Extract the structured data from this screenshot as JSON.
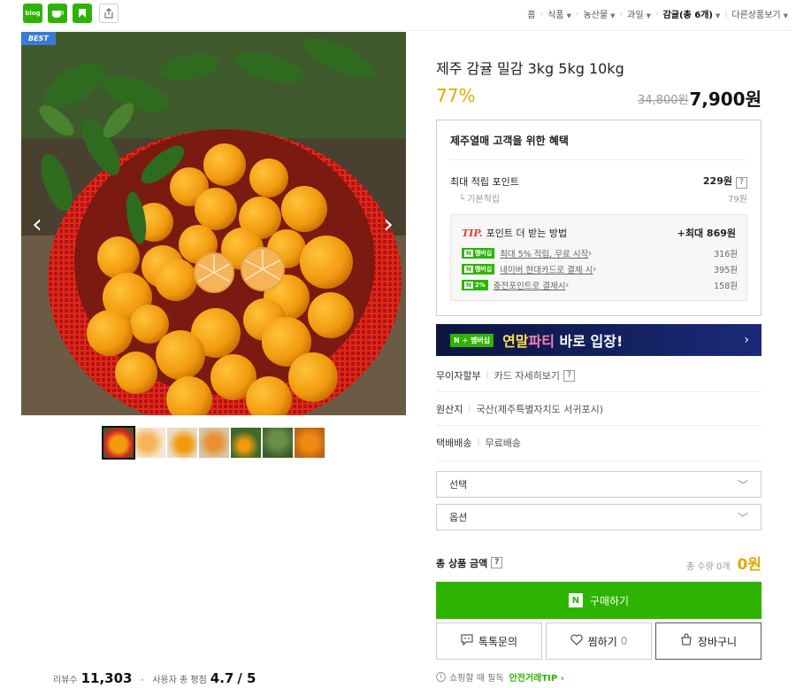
{
  "topbar": {
    "icons": [
      "blog-icon",
      "cafe-icon",
      "k-icon",
      "share-icon"
    ],
    "blog_label": "blog",
    "breadcrumbs": [
      "홈",
      "식품",
      "농산물",
      "과일"
    ],
    "current": "감귤(총 6개)",
    "more": "다른상품보기"
  },
  "product": {
    "badge": "BEST",
    "title": "제주 감귤 밀감 3kg 5kg 10kg",
    "discount": "77%",
    "original_price": "34,800원",
    "price": "7,900원",
    "thumbnail_count": 7
  },
  "benefit": {
    "title": "제주열매 고객을 위한 혜택",
    "max_points_label": "최대 적립 포인트",
    "max_points_value": "229원",
    "base_label": "기본적립",
    "base_value": "79원",
    "tip_tag": "TIP.",
    "tip_title": "포인트 더 받는 방법",
    "tip_max": "+최대 869원",
    "tips": [
      {
        "badge": "멤버십",
        "text": "최대 5% 적립, 무료 시작",
        "value": "316원"
      },
      {
        "badge": "멤버십",
        "text": "네이버 현대카드로 결제 시",
        "value": "395원"
      },
      {
        "badge": "2%",
        "text": "충전포인트로 결제시",
        "value": "158원"
      }
    ]
  },
  "banner": {
    "badge": "N + 멤버십",
    "text_a": "연말",
    "text_b": "파티",
    "text_c": " 바로 입장!",
    "arrow": "›"
  },
  "info": {
    "installment_label": "무이자할부",
    "installment_value": "카드 자세히보기",
    "origin_label": "원산지",
    "origin_value": "국산(제주특별자치도 서귀포시)",
    "delivery_label": "택배배송",
    "delivery_value": "무료배송"
  },
  "options": {
    "select1": "선택",
    "select2": "옵션"
  },
  "total": {
    "label": "총 상품 금액",
    "qty": "총 수량 0개",
    "price": "0원"
  },
  "actions": {
    "buy": "구매하기",
    "talk": "톡톡문의",
    "wish": "찜하기",
    "wish_count": "0",
    "cart": "장바구니"
  },
  "footer": {
    "safe_text": "쇼핑할 때 필독",
    "safe_link": "안전거래TIP ›"
  },
  "stats": {
    "reviews_label": "리뷰수",
    "reviews_value": "11,303",
    "rating_label": "사용자 총 평점",
    "rating_value": "4.7",
    "rating_max": "/ 5"
  },
  "colors": {
    "accent_green": "#2db400",
    "discount_gold": "#e3a800",
    "tip_red": "#e53a2f",
    "banner_navy": "#0b1540"
  }
}
